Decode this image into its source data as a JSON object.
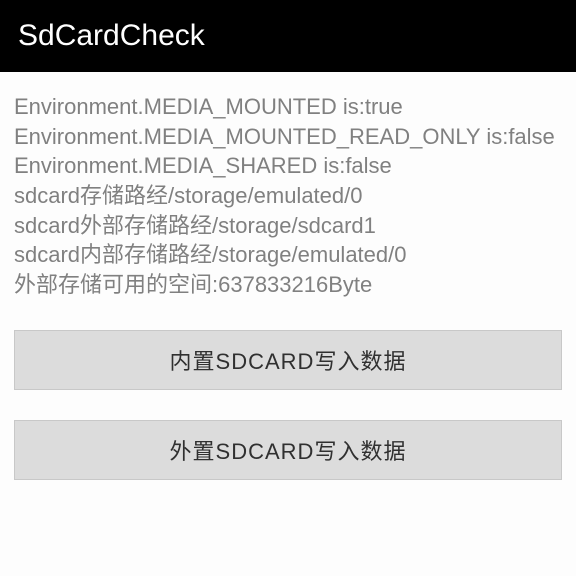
{
  "header": {
    "title": "SdCardCheck"
  },
  "info": {
    "lines": [
      "Environment.MEDIA_MOUNTED is:true",
      "Environment.MEDIA_MOUNTED_READ_ONLY is:false",
      "Environment.MEDIA_SHARED is:false",
      "sdcard存储路经/storage/emulated/0",
      "sdcard外部存储路经/storage/sdcard1",
      "sdcard内部存储路经/storage/emulated/0",
      "外部存储可用的空间:637833216Byte"
    ]
  },
  "buttons": {
    "write_internal": "内置SDCARD写入数据",
    "write_external": "外置SDCARD写入数据"
  }
}
